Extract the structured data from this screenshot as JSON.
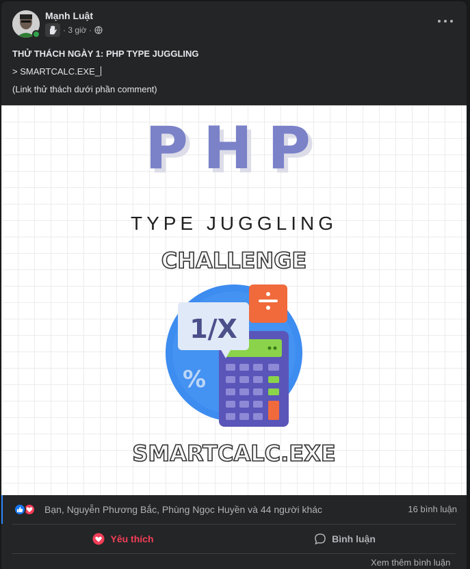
{
  "post": {
    "author": "Mạnh Luật",
    "time": "· 3 giờ ·",
    "badge_icon": "waving-hand-icon",
    "privacy_icon": "globe-icon",
    "options_icon": "more-icon",
    "lines": {
      "title": "THỬ THÁCH NGÀY 1: PHP TYPE JUGGLING",
      "command": "> SMARTCALC.EXE_",
      "note": "(Link thử thách dưới phần comment)"
    }
  },
  "image": {
    "title": "PHP",
    "subtitle": "TYPE JUGGLING",
    "challenge": "CHALLENGE",
    "screen_text": "1/X",
    "percent_text": "%",
    "footer": "SMARTCALC.EXE",
    "colors": {
      "php_blue": "#7b82c8",
      "circle_blue": "#3d8cf0",
      "calc_purple": "#5a55b8",
      "orange": "#f06a3c",
      "green": "#8ad34a"
    }
  },
  "reactions": {
    "icons": [
      "like-icon",
      "love-icon"
    ],
    "text": "Bạn, Nguyễn Phương Bắc, Phùng Ngọc Huyền và 44 người khác",
    "comments": "16 bình luận"
  },
  "actions": {
    "like_label": "Yêu thích",
    "comment_label": "Bình luận"
  },
  "partial_text": "Xem thêm bình luận"
}
